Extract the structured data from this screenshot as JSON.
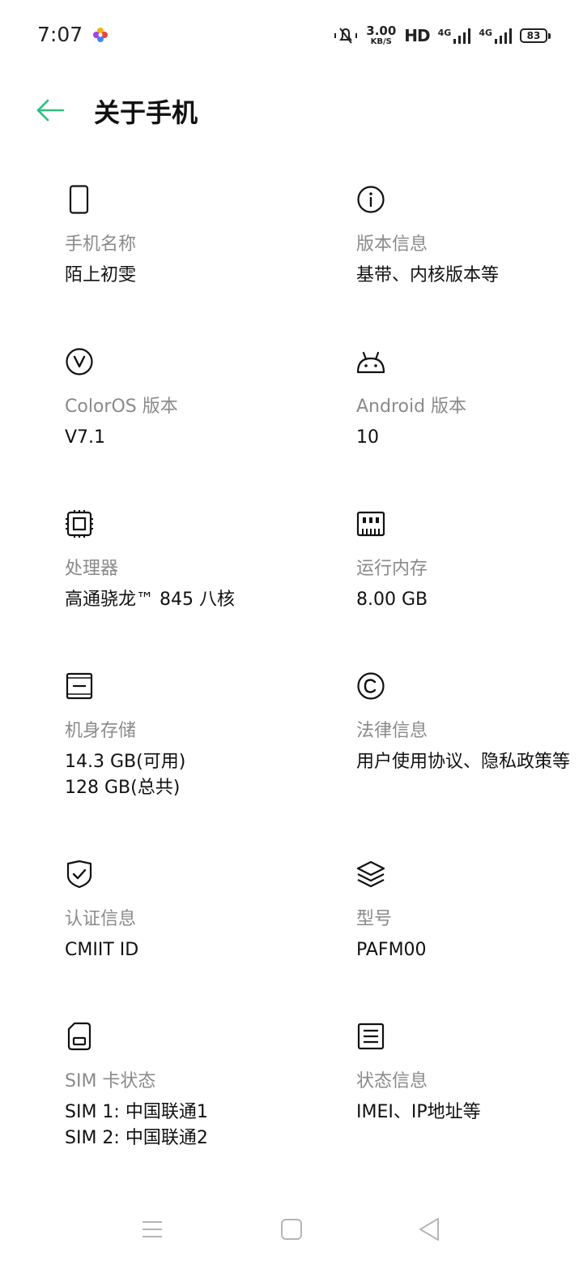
{
  "status_bar": {
    "time": "7:07",
    "net_speed_value": "3.00",
    "net_speed_unit": "KB/S",
    "hd_label": "HD",
    "net1": "4G",
    "net2": "4G",
    "battery": "83"
  },
  "header": {
    "title": "关于手机"
  },
  "items": [
    {
      "label": "手机名称",
      "value": "陌上初雯",
      "icon": "phone-icon"
    },
    {
      "label": "版本信息",
      "value": "基带、内核版本等",
      "icon": "info-icon"
    },
    {
      "label": "ColorOS 版本",
      "value": "V7.1",
      "icon": "coloros-v-icon"
    },
    {
      "label": "Android 版本",
      "value": "10",
      "icon": "android-icon"
    },
    {
      "label": "处理器",
      "value": "高通骁龙™ 845 八核",
      "icon": "cpu-icon"
    },
    {
      "label": "运行内存",
      "value": "8.00 GB",
      "icon": "ram-icon"
    },
    {
      "label": "机身存储",
      "value": "14.3 GB(可用)",
      "value2": "128 GB(总共)",
      "icon": "storage-icon"
    },
    {
      "label": "法律信息",
      "value": "用户使用协议、隐私政策等",
      "icon": "copyright-icon"
    },
    {
      "label": "认证信息",
      "value": "CMIIT ID",
      "icon": "shield-check-icon"
    },
    {
      "label": "型号",
      "value": "PAFM00",
      "icon": "layers-icon"
    },
    {
      "label": "SIM 卡状态",
      "value": "SIM 1: 中国联通1",
      "value2": "SIM 2: 中国联通2",
      "icon": "sim-card-icon"
    },
    {
      "label": "状态信息",
      "value": "IMEI、IP地址等",
      "icon": "document-lines-icon"
    }
  ],
  "colors": {
    "accent": "#2DBE7E",
    "label": "#8A8A8A",
    "text": "#111111"
  }
}
